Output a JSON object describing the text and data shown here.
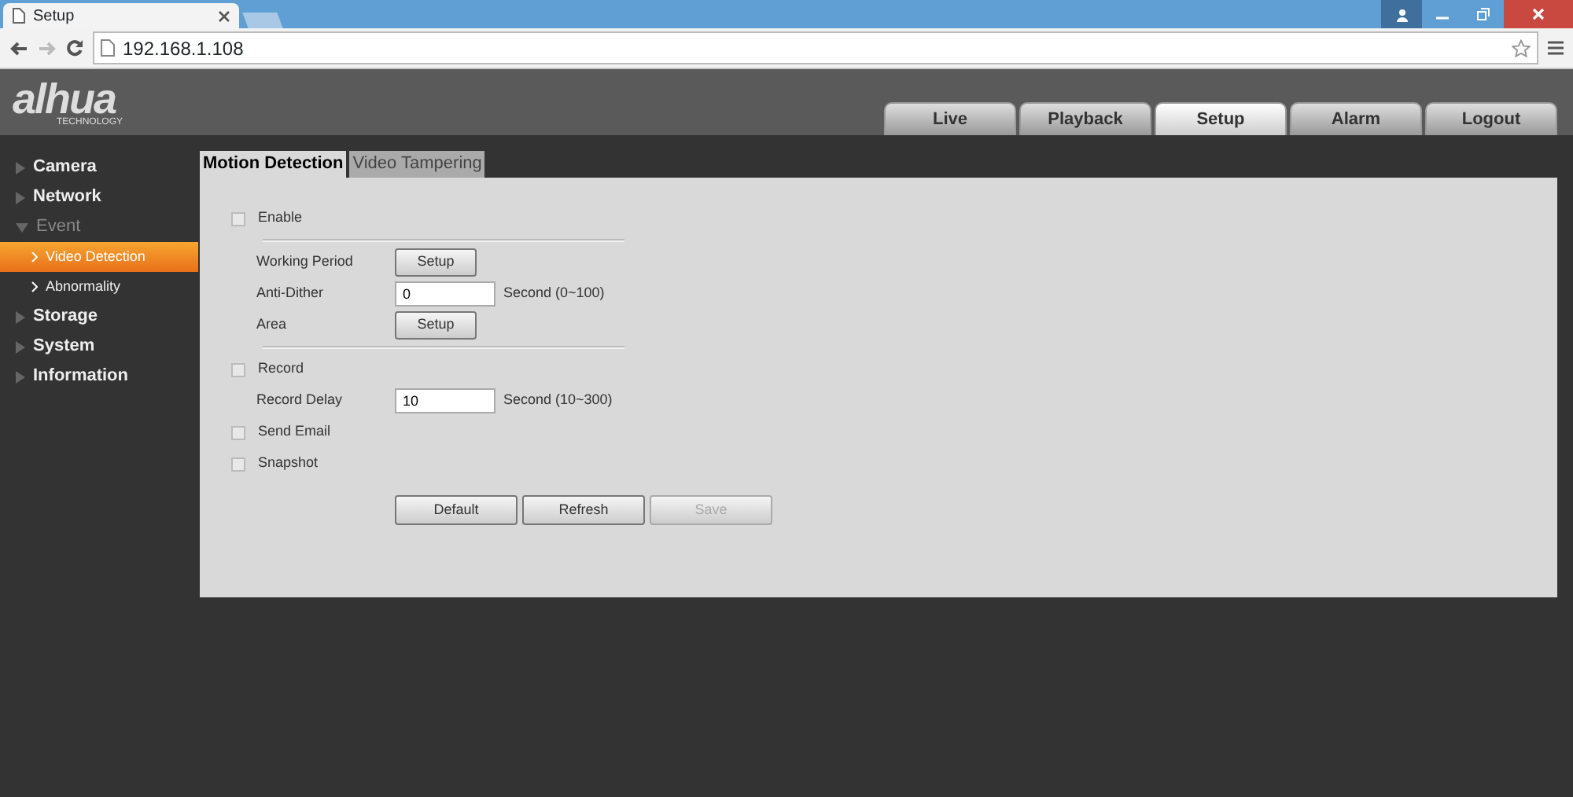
{
  "browser": {
    "tabs": [
      {
        "title": "Setup",
        "selected": true
      }
    ],
    "address": "192.168.1.108"
  },
  "header": {
    "logo": "alhua",
    "logo_subtitle": "TECHNOLOGY",
    "nav": [
      {
        "label": "Live",
        "selected": false
      },
      {
        "label": "Playback",
        "selected": false
      },
      {
        "label": "Setup",
        "selected": true
      },
      {
        "label": "Alarm",
        "selected": false
      },
      {
        "label": "Logout",
        "selected": false
      }
    ]
  },
  "sidebar": {
    "items": [
      {
        "label": "Camera",
        "expanded": false,
        "selected": false
      },
      {
        "label": "Network",
        "expanded": false,
        "selected": false
      },
      {
        "label": "Event",
        "expanded": true,
        "selected": false,
        "children": [
          {
            "label": "Video Detection",
            "selected": true
          },
          {
            "label": "Abnormality",
            "selected": false
          }
        ]
      },
      {
        "label": "Storage",
        "expanded": false,
        "selected": false
      },
      {
        "label": "System",
        "expanded": false,
        "selected": false
      },
      {
        "label": "Information",
        "expanded": false,
        "selected": false
      }
    ]
  },
  "tabs": [
    {
      "label": "Motion Detection",
      "selected": true
    },
    {
      "label": "Video Tampering",
      "selected": false
    }
  ],
  "form": [
    {
      "kind": "checkbox",
      "label": "Enable",
      "checked": false
    },
    {
      "kind": "divider"
    },
    {
      "kind": "button",
      "label": "Working Period",
      "button": "Setup"
    },
    {
      "kind": "input",
      "label": "Anti-Dither",
      "value": "0",
      "hint": "Second (0~100)"
    },
    {
      "kind": "button",
      "label": "Area",
      "button": "Setup"
    },
    {
      "kind": "divider"
    },
    {
      "kind": "checkbox",
      "label": "Record",
      "checked": false
    },
    {
      "kind": "input",
      "label": "Record Delay",
      "value": "10",
      "hint": "Second (10~300)"
    },
    {
      "kind": "checkbox",
      "label": "Send Email",
      "checked": false
    },
    {
      "kind": "checkbox",
      "label": "Snapshot",
      "checked": false
    }
  ],
  "actions": [
    {
      "label": "Default",
      "disabled": false
    },
    {
      "label": "Refresh",
      "disabled": false
    },
    {
      "label": "Save",
      "disabled": true
    }
  ]
}
